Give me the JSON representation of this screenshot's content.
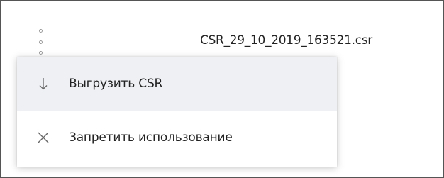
{
  "file": {
    "name": "CSR_29_10_2019_163521.csr",
    "more_icon": "vertical-dots-icon"
  },
  "menu": {
    "items": [
      {
        "label": "Выгрузить CSR",
        "icon": "arrow-down-icon",
        "highlighted": true
      },
      {
        "label": "Запретить использование",
        "icon": "close-icon",
        "highlighted": false
      }
    ]
  },
  "colors": {
    "hover_background": "#eef0f4",
    "text": "#222222",
    "icon": "#666666",
    "frame_border": "#555555"
  }
}
